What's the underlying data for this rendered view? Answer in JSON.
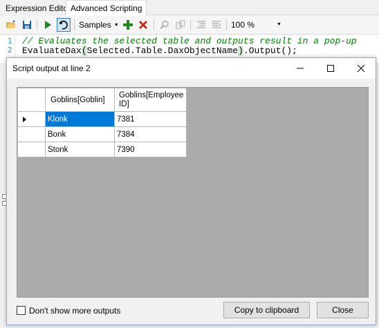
{
  "tabs": [
    {
      "label": "Expression Editor",
      "active": false
    },
    {
      "label": "Advanced Scripting",
      "active": true
    }
  ],
  "toolbar": {
    "samples_label": "Samples",
    "zoom_value": "100 %"
  },
  "icons": {
    "open": "folder-open-icon",
    "save": "save-icon",
    "run": "play-icon",
    "undo": "undo-icon",
    "add": "plus-icon",
    "remove": "x-icon",
    "search": "search-icon",
    "copy": "copy-icon",
    "comment": "comment-icon",
    "uncomment": "uncomment-icon"
  },
  "editor": {
    "lines": [
      {
        "number": "1",
        "text": "// Evaluates the selected table and outputs result in a pop-up"
      },
      {
        "number": "2",
        "pre": "EvaluateDax",
        "open": "(",
        "mid": "Selected.Table.DaxObjectName",
        "close": ")",
        "post": ".Output();"
      }
    ]
  },
  "dialog": {
    "title": "Script output at line 2",
    "columns": [
      "Goblins[Goblin]",
      "Goblins[Employee ID]"
    ],
    "rows": [
      [
        "Klonk",
        "7381"
      ],
      [
        "Bonk",
        "7384"
      ],
      [
        "Stonk",
        "7390"
      ]
    ],
    "checkbox_label": "Don't show more outputs",
    "copy_button": "Copy to clipboard",
    "close_button": "Close"
  },
  "colors": {
    "selection": "#0078d7",
    "comment": "#008000",
    "line_number": "#2b91af",
    "run_green": "#1e8a1e",
    "remove_red": "#c42b1c"
  }
}
